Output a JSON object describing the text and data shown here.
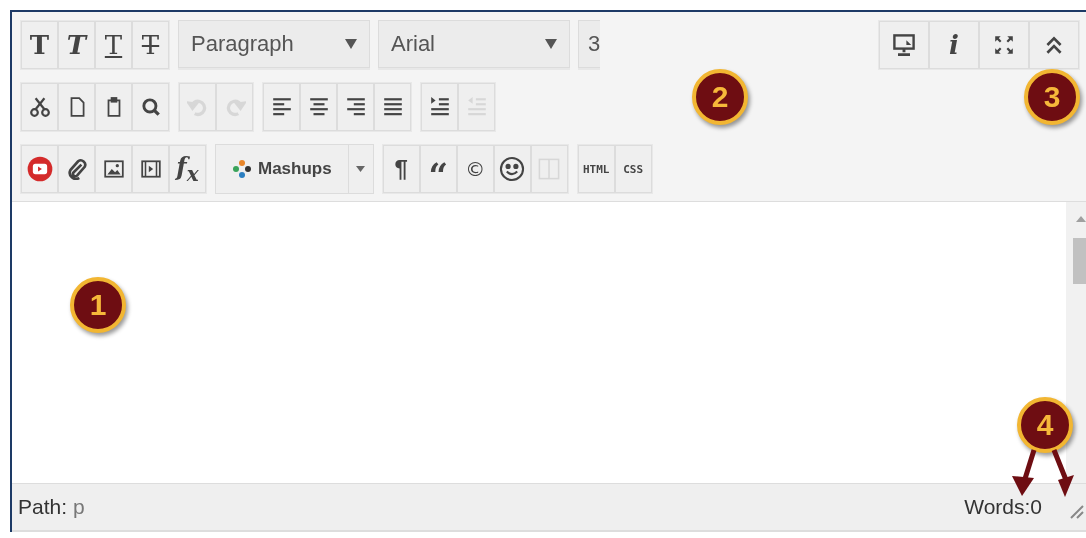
{
  "toolbar": {
    "rows": [
      {
        "groups": [
          {
            "items": [
              {
                "kind": "bold",
                "label": "T",
                "disabled": false
              },
              {
                "kind": "italic",
                "label": "T",
                "disabled": false
              },
              {
                "kind": "underline",
                "label": "T",
                "disabled": false
              },
              {
                "kind": "strike",
                "label": "T",
                "disabled": false
              }
            ]
          },
          {
            "items": [
              {
                "kind": "select",
                "value": "Paragraph"
              }
            ]
          },
          {
            "items": [
              {
                "kind": "select",
                "value": "Arial"
              }
            ]
          },
          {
            "items": [
              {
                "kind": "select-cut",
                "value": "3"
              }
            ]
          }
        ]
      },
      {
        "groups": [
          {
            "items": [
              {
                "kind": "cut",
                "disabled": false
              },
              {
                "kind": "copy",
                "disabled": false
              },
              {
                "kind": "paste",
                "disabled": false
              },
              {
                "kind": "find",
                "disabled": false
              }
            ]
          },
          {
            "items": [
              {
                "kind": "undo",
                "disabled": true
              },
              {
                "kind": "redo",
                "disabled": true
              }
            ]
          },
          {
            "items": [
              {
                "kind": "align-left",
                "disabled": false
              },
              {
                "kind": "align-center",
                "disabled": false
              },
              {
                "kind": "align-right",
                "disabled": false
              },
              {
                "kind": "justify",
                "disabled": false
              }
            ]
          },
          {
            "items": [
              {
                "kind": "indent",
                "disabled": false
              },
              {
                "kind": "outdent",
                "disabled": true
              }
            ]
          }
        ]
      },
      {
        "groups": [
          {
            "items": [
              {
                "kind": "video",
                "disabled": false
              },
              {
                "kind": "attach",
                "disabled": false
              },
              {
                "kind": "image",
                "disabled": false
              },
              {
                "kind": "media",
                "disabled": false
              },
              {
                "kind": "formula",
                "label": "f$_{x}$",
                "disabled": false
              }
            ]
          },
          {
            "items": [
              {
                "kind": "split",
                "label": "Mashups"
              }
            ]
          },
          {
            "items": [
              {
                "kind": "pilcrow",
                "label": "¶",
                "disabled": false
              },
              {
                "kind": "quote",
                "label": "“",
                "disabled": false
              },
              {
                "kind": "copyright",
                "label": "©",
                "disabled": false
              },
              {
                "kind": "emoji",
                "disabled": false
              },
              {
                "kind": "columns",
                "disabled": true
              }
            ]
          },
          {
            "items": [
              {
                "kind": "html",
                "label": "HTML",
                "disabled": false
              },
              {
                "kind": "css",
                "label": "CSS",
                "disabled": false
              }
            ]
          }
        ]
      }
    ],
    "side_tools": [
      {
        "kind": "preview",
        "disabled": false
      },
      {
        "kind": "info",
        "label": "i",
        "disabled": false
      },
      {
        "kind": "fullscreen",
        "disabled": false
      },
      {
        "kind": "collapse",
        "disabled": false
      }
    ]
  },
  "status_bar": {
    "path_label": "Path:",
    "path": "p",
    "words": "Words:0"
  },
  "callouts": [
    {
      "label": "1"
    },
    {
      "label": "2"
    },
    {
      "label": "3"
    },
    {
      "label": "4"
    }
  ]
}
